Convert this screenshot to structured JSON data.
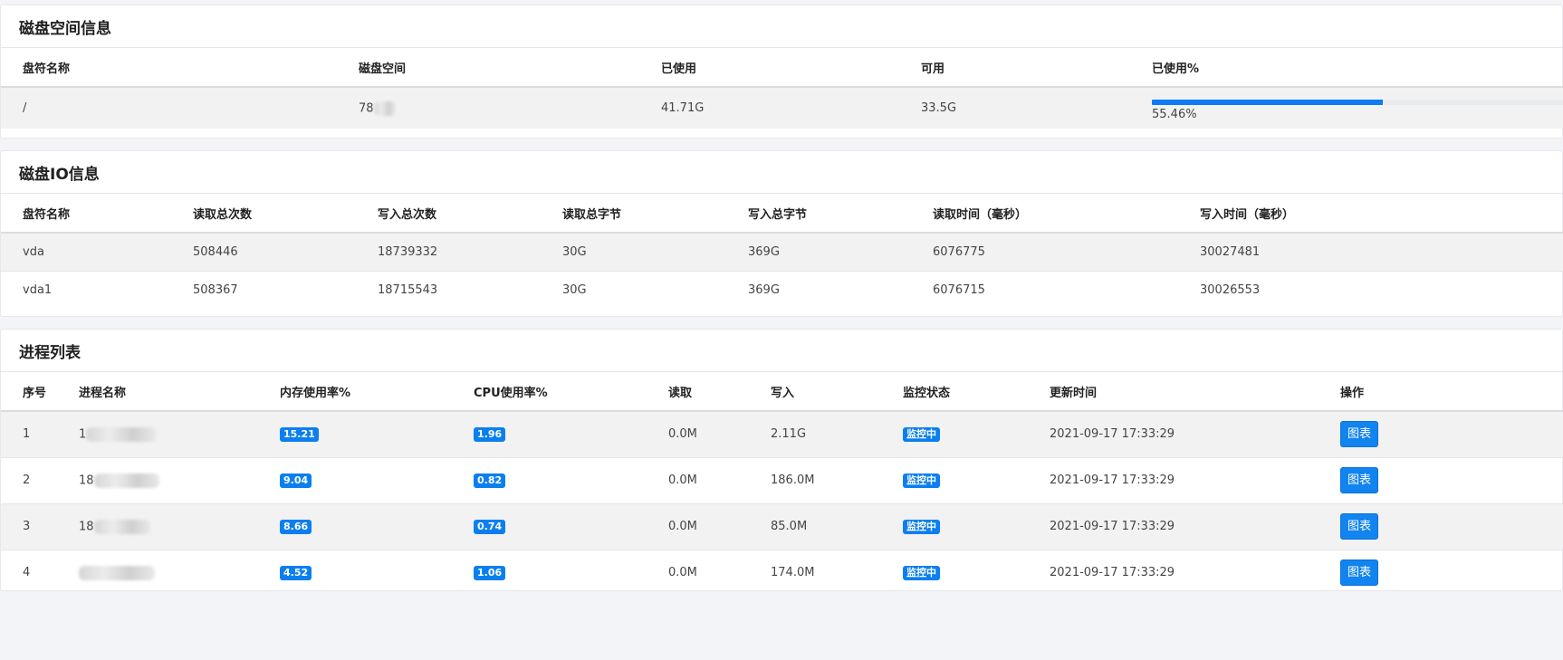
{
  "disk_space": {
    "title": "磁盘空间信息",
    "columns": [
      "盘符名称",
      "磁盘空间",
      "已使用",
      "可用",
      "已使用%"
    ],
    "rows": [
      {
        "name": "/",
        "size_prefix": "78",
        "used": "41.71G",
        "available": "33.5G",
        "percent_label": "55.46%",
        "percent_value": 55.46
      }
    ]
  },
  "disk_io": {
    "title": "磁盘IO信息",
    "columns": [
      "盘符名称",
      "读取总次数",
      "写入总次数",
      "读取总字节",
      "写入总字节",
      "读取时间（毫秒）",
      "写入时间（毫秒）"
    ],
    "rows": [
      {
        "name": "vda",
        "read_count": "508446",
        "write_count": "18739332",
        "read_bytes": "30G",
        "write_bytes": "369G",
        "read_time": "6076775",
        "write_time": "30027481"
      },
      {
        "name": "vda1",
        "read_count": "508367",
        "write_count": "18715543",
        "read_bytes": "30G",
        "write_bytes": "369G",
        "read_time": "6076715",
        "write_time": "30026553"
      }
    ]
  },
  "process_list": {
    "title": "进程列表",
    "columns": [
      "序号",
      "进程名称",
      "内存使用率%",
      "CPU使用率%",
      "读取",
      "写入",
      "监控状态",
      "更新时间",
      "操作"
    ],
    "rows": [
      {
        "index": "1",
        "name_prefix": "1",
        "mem": "15.21",
        "cpu": "1.96",
        "read": "0.0M",
        "write": "2.11G",
        "status": "监控中",
        "updated": "2021-09-17 17:33:29",
        "action": "图表"
      },
      {
        "index": "2",
        "name_prefix": "18",
        "mem": "9.04",
        "cpu": "0.82",
        "read": "0.0M",
        "write": "186.0M",
        "status": "监控中",
        "updated": "2021-09-17 17:33:29",
        "action": "图表"
      },
      {
        "index": "3",
        "name_prefix": "18",
        "mem": "8.66",
        "cpu": "0.74",
        "read": "0.0M",
        "write": "85.0M",
        "status": "监控中",
        "updated": "2021-09-17 17:33:29",
        "action": "图表"
      },
      {
        "index": "4",
        "name_prefix": "",
        "mem": "4.52",
        "cpu": "1.06",
        "read": "0.0M",
        "write": "174.0M",
        "status": "监控中",
        "updated": "2021-09-17 17:33:29",
        "action": "图表"
      }
    ]
  },
  "colors": {
    "accent": "#0d7cf2",
    "badge": "#0b7ff0",
    "button": "#1284f0",
    "stripe": "#f2f2f2"
  }
}
